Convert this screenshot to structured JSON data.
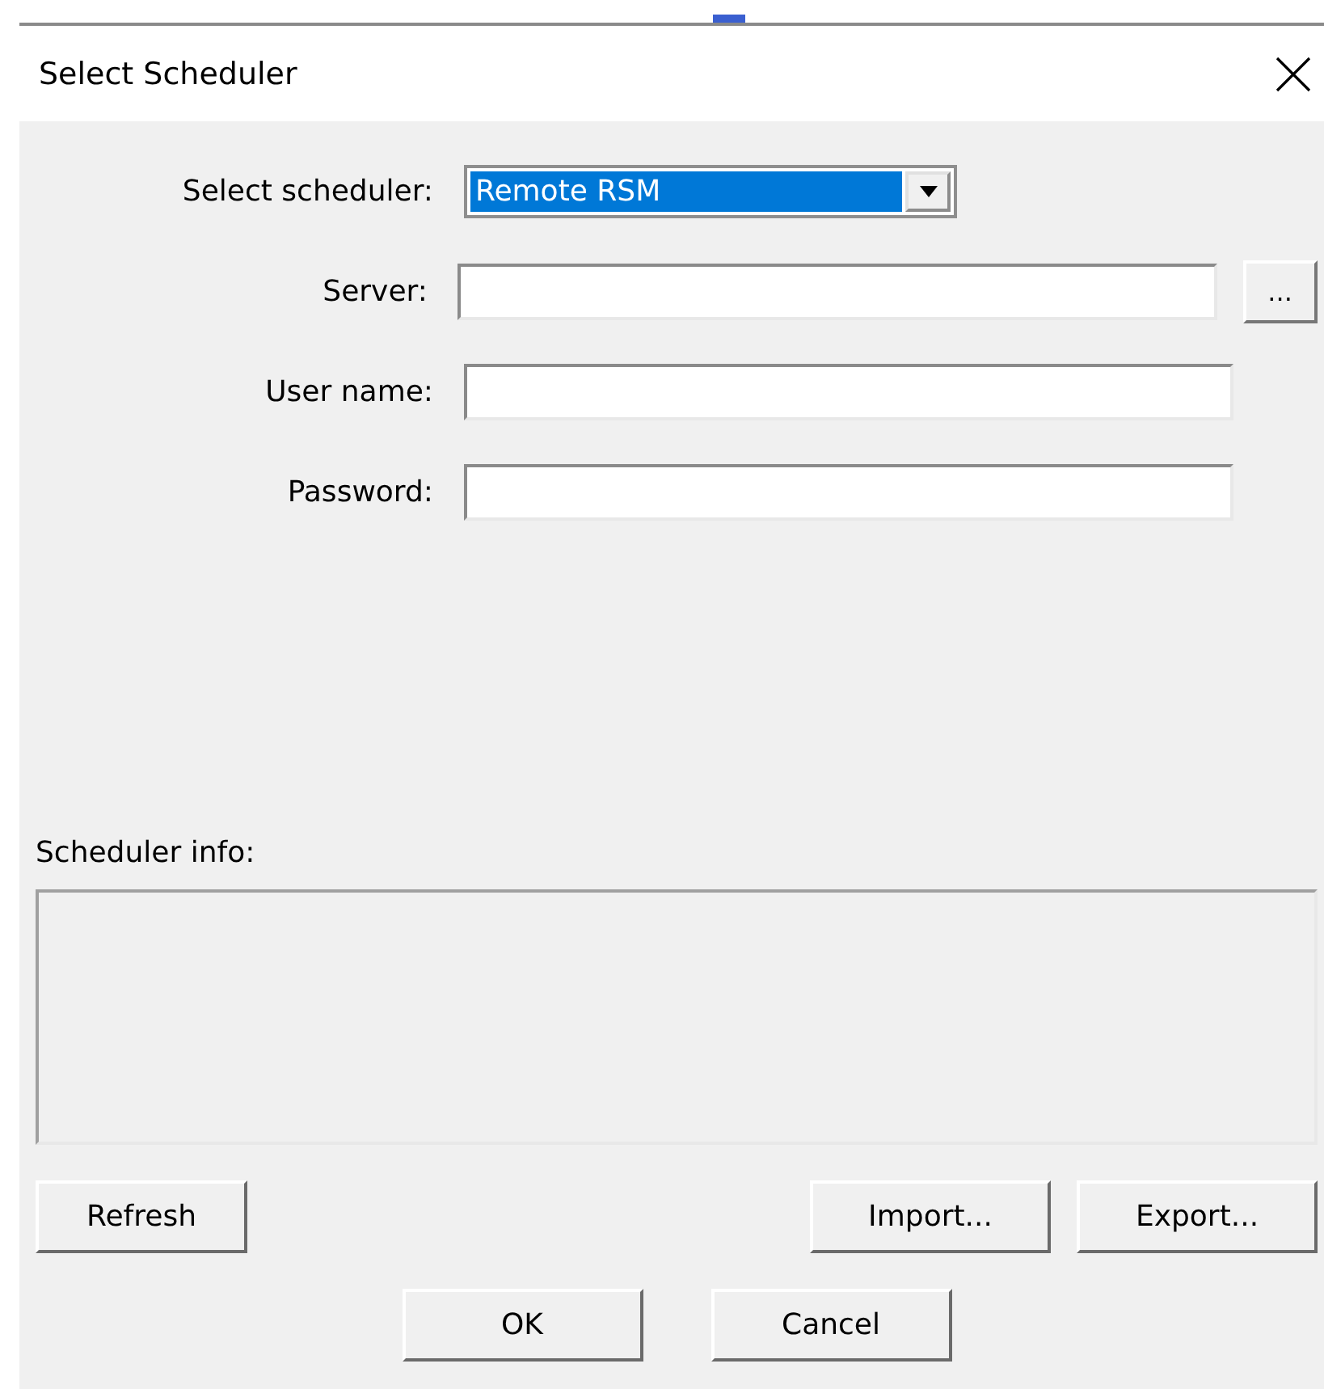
{
  "window": {
    "title": "Select Scheduler"
  },
  "fields": [
    {
      "kind": "dropdown",
      "label": "Select scheduler:",
      "value": "Remote RSM"
    },
    {
      "kind": "text",
      "label": "Server:",
      "browse": "..."
    },
    {
      "kind": "text",
      "label": "User name:"
    },
    {
      "kind": "text",
      "label": "Password:"
    }
  ],
  "info": {
    "label": "Scheduler info:"
  },
  "buttons": {
    "left": [
      "Refresh"
    ],
    "right": [
      "Import...",
      "Export..."
    ],
    "bottom": [
      "OK",
      "Cancel"
    ]
  }
}
